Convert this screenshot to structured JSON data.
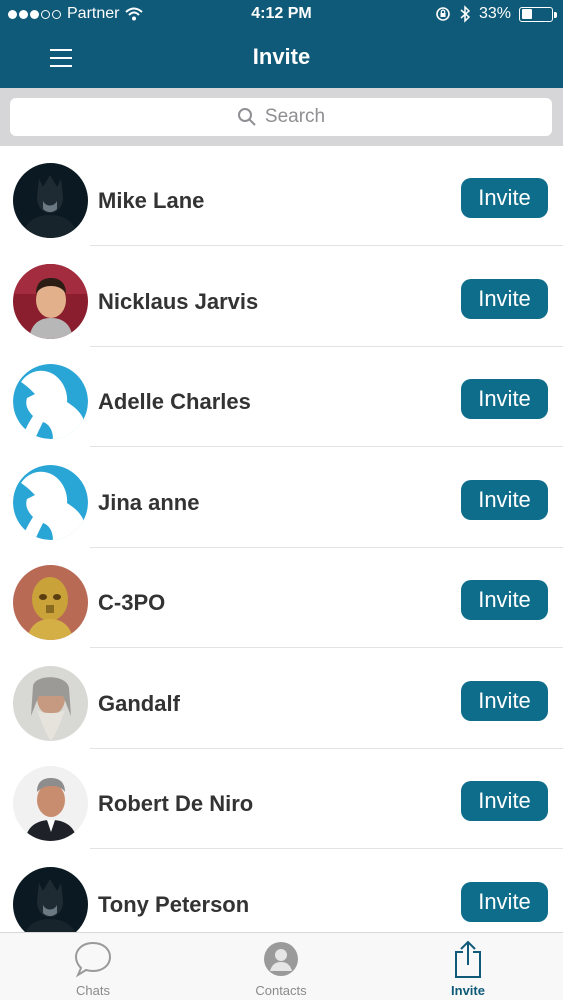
{
  "status_bar": {
    "carrier": "Partner",
    "time": "4:12 PM",
    "battery": "33%",
    "battery_level": 0.33
  },
  "nav": {
    "title": "Invite",
    "menu_icon": "hamburger-menu-icon"
  },
  "search": {
    "placeholder": "Search",
    "icon": "search-icon"
  },
  "contacts": [
    {
      "name": "Mike Lane",
      "avatar": "batman-photo",
      "action": "Invite"
    },
    {
      "name": "Nicklaus Jarvis",
      "avatar": "man-photo",
      "action": "Invite"
    },
    {
      "name": "Adelle Charles",
      "avatar": "default-avatar",
      "action": "Invite"
    },
    {
      "name": "Jina anne",
      "avatar": "default-avatar",
      "action": "Invite"
    },
    {
      "name": "C-3PO",
      "avatar": "c3po-photo",
      "action": "Invite"
    },
    {
      "name": "Gandalf",
      "avatar": "gandalf-photo",
      "action": "Invite"
    },
    {
      "name": "Robert De Niro",
      "avatar": "actor-photo",
      "action": "Invite"
    },
    {
      "name": "Tony Peterson",
      "avatar": "batman-photo",
      "action": "Invite"
    }
  ],
  "tabs": [
    {
      "label": "Chats",
      "icon": "chat-bubble-icon",
      "active": false
    },
    {
      "label": "Contacts",
      "icon": "contacts-icon",
      "active": false
    },
    {
      "label": "Invite",
      "icon": "share-icon",
      "active": true
    }
  ],
  "colors": {
    "header": "#0f5a78",
    "button": "#0f6d8c",
    "default_avatar": "#2aa6d6"
  }
}
